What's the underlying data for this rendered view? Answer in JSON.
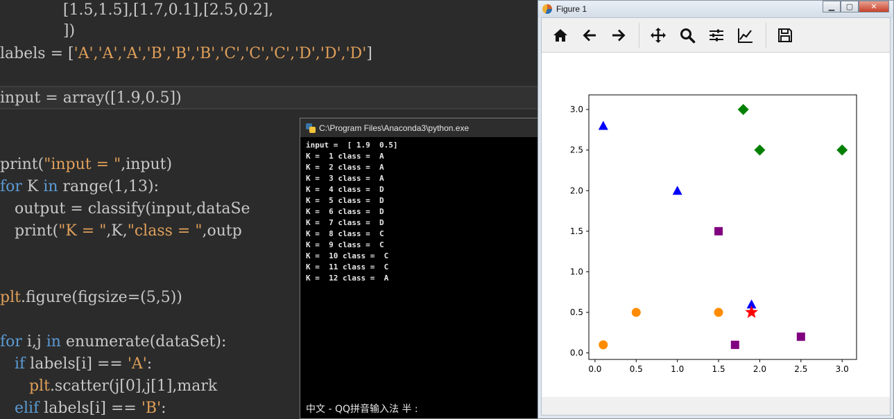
{
  "editor": {
    "lines": [
      {
        "top": 0,
        "segments": [
          {
            "t": "             [1.5,1.5],[1.7,0.1],[2.5,0.2],",
            "c": ""
          }
        ]
      },
      {
        "top": 30,
        "segments": [
          {
            "t": "             ])",
            "c": ""
          }
        ]
      },
      {
        "top": 63,
        "segments": [
          {
            "t": "labels = [",
            "c": ""
          },
          {
            "t": "'A','A','A','B','B','B','C','C','C','D','D','D'",
            "c": "str"
          },
          {
            "t": "]",
            "c": ""
          }
        ]
      },
      {
        "top": 127,
        "segments": [
          {
            "t": "input = array([1.9,0.5])",
            "c": ""
          }
        ]
      },
      {
        "top": 223,
        "segments": [
          {
            "t": "print(",
            "c": ""
          },
          {
            "t": "\"input = \"",
            "c": "str"
          },
          {
            "t": ",input)",
            "c": ""
          }
        ]
      },
      {
        "top": 255,
        "segments": [
          {
            "t": "for",
            "c": "kw"
          },
          {
            "t": " K ",
            "c": ""
          },
          {
            "t": "in",
            "c": "kw"
          },
          {
            "t": " range(1,13):",
            "c": ""
          }
        ]
      },
      {
        "top": 287,
        "segments": [
          {
            "t": "   output = classify(input,dataSe",
            "c": ""
          }
        ]
      },
      {
        "top": 319,
        "segments": [
          {
            "t": "   print(",
            "c": ""
          },
          {
            "t": "\"K = \"",
            "c": "str"
          },
          {
            "t": ",K,",
            "c": ""
          },
          {
            "t": "\"class = \"",
            "c": "str"
          },
          {
            "t": ",outp",
            "c": ""
          }
        ]
      },
      {
        "top": 415,
        "segments": [
          {
            "t": "plt",
            "c": "str"
          },
          {
            "t": ".figure(figsize=(5,5))",
            "c": ""
          }
        ]
      },
      {
        "top": 479,
        "segments": [
          {
            "t": "for",
            "c": "kw"
          },
          {
            "t": " i,j ",
            "c": ""
          },
          {
            "t": "in",
            "c": "kw"
          },
          {
            "t": " enumerate(dataSet):",
            "c": ""
          }
        ]
      },
      {
        "top": 511,
        "segments": [
          {
            "t": "   ",
            "c": ""
          },
          {
            "t": "if",
            "c": "kw"
          },
          {
            "t": " labels[i] == ",
            "c": ""
          },
          {
            "t": "'A'",
            "c": "str"
          },
          {
            "t": ":",
            "c": ""
          }
        ]
      },
      {
        "top": 543,
        "segments": [
          {
            "t": "      ",
            "c": ""
          },
          {
            "t": "plt",
            "c": "str"
          },
          {
            "t": ".scatter(j[0],j[1],mark",
            "c": ""
          }
        ]
      },
      {
        "top": 575,
        "segments": [
          {
            "t": "   ",
            "c": ""
          },
          {
            "t": "elif",
            "c": "kw"
          },
          {
            "t": " labels[i] == ",
            "c": ""
          },
          {
            "t": "'B'",
            "c": "str"
          },
          {
            "t": ":",
            "c": ""
          }
        ]
      }
    ]
  },
  "console": {
    "title": "C:\\Program Files\\Anaconda3\\python.exe",
    "output": "input =  [ 1.9  0.5]\nK =  1 class =  A\nK =  2 class =  A\nK =  3 class =  A\nK =  4 class =  D\nK =  5 class =  D\nK =  6 class =  D\nK =  7 class =  D\nK =  8 class =  C\nK =  9 class =  C\nK =  10 class =  C\nK =  11 class =  C\nK =  12 class =  A",
    "ime_status": "中文 - QQ拼音输入法 半 :"
  },
  "figure": {
    "title": "Figure 1",
    "window_buttons": {
      "minimize": "▁",
      "maximize": "▢",
      "close": "✕"
    },
    "toolbar": [
      "home-icon",
      "back-icon",
      "forward-icon",
      "pan-icon",
      "zoom-icon",
      "configure-subplots-icon",
      "edit-axis-icon",
      "save-icon"
    ]
  },
  "chart_data": {
    "type": "scatter",
    "title": "",
    "xlabel": "",
    "ylabel": "",
    "xlim": [
      -0.075,
      3.175
    ],
    "ylim": [
      -0.08,
      3.18
    ],
    "xticks": [
      "0.0",
      "0.5",
      "1.0",
      "1.5",
      "2.0",
      "2.5",
      "3.0"
    ],
    "yticks": [
      "0.0",
      "0.5",
      "1.0",
      "1.5",
      "2.0",
      "2.5",
      "3.0"
    ],
    "grid": false,
    "series": [
      {
        "marker": "circle",
        "color": "#ff8c00",
        "points": [
          [
            0.1,
            0.1
          ],
          [
            0.5,
            0.5
          ],
          [
            1.5,
            0.5
          ]
        ]
      },
      {
        "marker": "triangle",
        "color": "#0000ff",
        "points": [
          [
            0.1,
            2.8
          ],
          [
            1.0,
            2.0
          ],
          [
            1.9,
            0.6
          ]
        ]
      },
      {
        "marker": "diamond",
        "color": "#008000",
        "points": [
          [
            1.8,
            3.0
          ],
          [
            2.0,
            2.5
          ],
          [
            3.0,
            2.5
          ]
        ]
      },
      {
        "marker": "square",
        "color": "#800080",
        "points": [
          [
            1.5,
            1.5
          ],
          [
            1.7,
            0.1
          ],
          [
            2.5,
            0.2
          ]
        ]
      },
      {
        "marker": "star",
        "color": "#ff0000",
        "points": [
          [
            1.9,
            0.5
          ]
        ]
      }
    ]
  }
}
